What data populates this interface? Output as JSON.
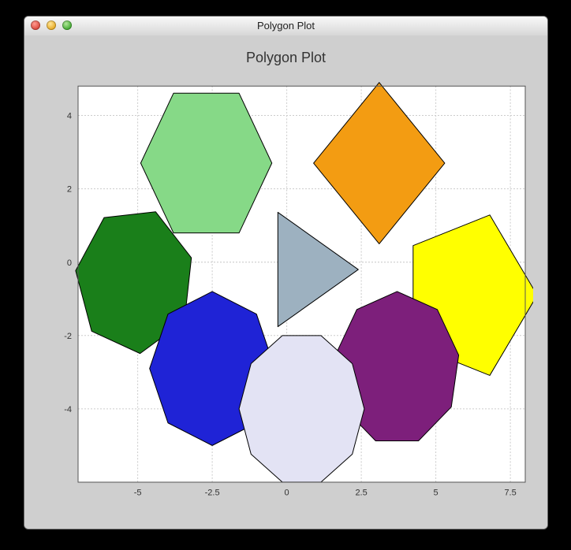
{
  "window": {
    "title": "Polygon Plot"
  },
  "chart_data": {
    "type": "scatter",
    "title": "Polygon Plot",
    "xlabel": "",
    "ylabel": "",
    "xlim": [
      -7.0,
      8.0
    ],
    "ylim": [
      -6.0,
      4.8
    ],
    "x_ticks": [
      -5,
      -2.5,
      0,
      2.5,
      5,
      7.5
    ],
    "y_ticks": [
      -4,
      -2,
      0,
      2,
      4
    ],
    "grid": true,
    "polygons": [
      {
        "name": "triangle",
        "sides": 3,
        "cx": 0.6,
        "cy": -0.2,
        "r": 1.8,
        "rot": 0,
        "fill": "#9DB1C0"
      },
      {
        "name": "diamond",
        "sides": 4,
        "cx": 3.1,
        "cy": 2.7,
        "r": 2.2,
        "rot": 0,
        "fill": "#F39C12"
      },
      {
        "name": "pentagon",
        "sides": 5,
        "cx": 6.1,
        "cy": -0.9,
        "r": 2.3,
        "rot": 0,
        "fill": "#FFFF00"
      },
      {
        "name": "hexagon-l",
        "sides": 6,
        "cx": -2.7,
        "cy": 2.7,
        "r": 2.2,
        "rot": 0,
        "fill": "#86D987"
      },
      {
        "name": "heptagon",
        "sides": 7,
        "cx": -5.1,
        "cy": -0.5,
        "r": 2.0,
        "rot": 18,
        "fill": "#1A7F1A"
      },
      {
        "name": "octagon",
        "sides": 8,
        "cx": -2.5,
        "cy": -2.9,
        "r": 2.1,
        "rot": 0,
        "fill": "#1F23D6"
      },
      {
        "name": "nonagon",
        "sides": 9,
        "cx": 3.7,
        "cy": -2.9,
        "r": 2.1,
        "rot": 10,
        "fill": "#7D1F7B"
      },
      {
        "name": "decagon",
        "sides": 10,
        "cx": 0.5,
        "cy": -4.0,
        "r": 2.1,
        "rot": 0,
        "fill": "#E3E3F4"
      }
    ],
    "colors": {
      "grid": "#cccccc",
      "plot_bg": "#ffffff",
      "figure_bg": "#cfcfcf"
    }
  }
}
